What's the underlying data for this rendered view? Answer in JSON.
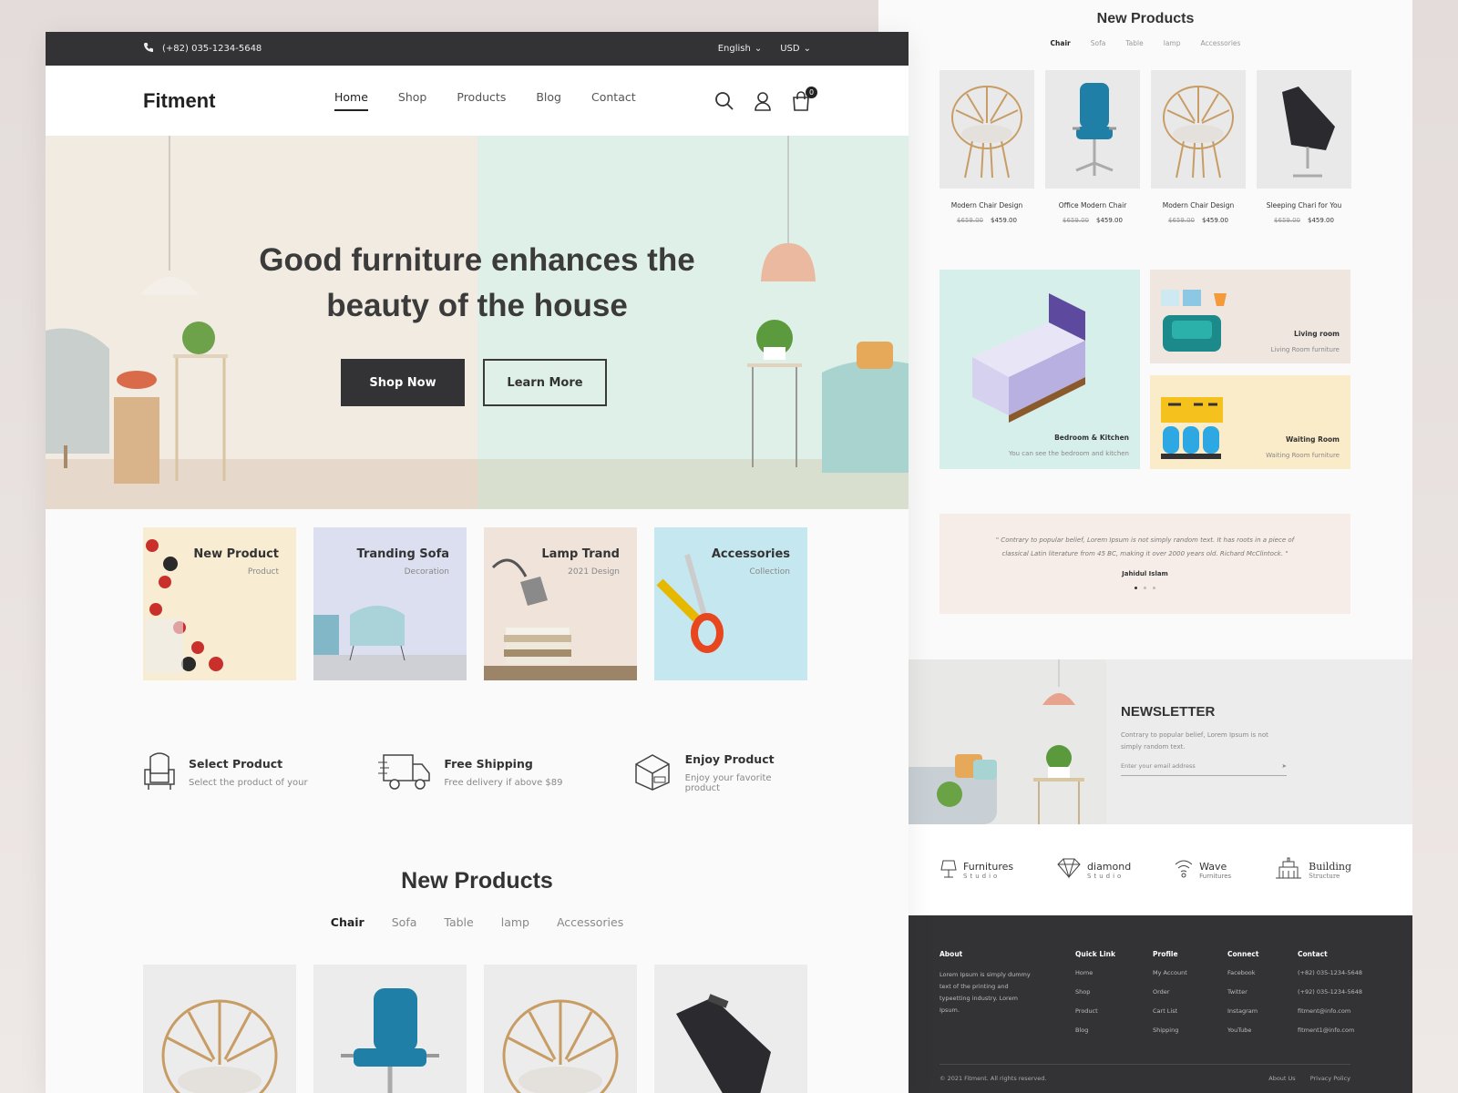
{
  "topbar": {
    "phone": "(+82) 035-1234-5648",
    "language": "English",
    "currency": "USD"
  },
  "nav": {
    "logo": "Fitment",
    "items": [
      {
        "label": "Home"
      },
      {
        "label": "Shop"
      },
      {
        "label": "Products"
      },
      {
        "label": "Blog"
      },
      {
        "label": "Contact"
      }
    ],
    "active_index": 0,
    "cart_count": "0"
  },
  "hero": {
    "headline_line1": "Good furniture enhances the",
    "headline_line2": "beauty of the house",
    "primary_cta": "Shop Now",
    "secondary_cta": "Learn More"
  },
  "categories": [
    {
      "title": "New Product",
      "subtitle": "Product"
    },
    {
      "title": "Tranding Sofa",
      "subtitle": "Decoration"
    },
    {
      "title": "Lamp Trand",
      "subtitle": "2021 Design"
    },
    {
      "title": "Accessories",
      "subtitle": "Collection"
    }
  ],
  "features": [
    {
      "title": "Select Product",
      "subtitle": "Select the product of your",
      "icon": "armchair-icon"
    },
    {
      "title": "Free Shipping",
      "subtitle": "Free delivery if above $89",
      "icon": "truck-icon"
    },
    {
      "title": "Enjoy Product",
      "subtitle": "Enjoy your favorite product",
      "icon": "box-icon"
    }
  ],
  "new_products": {
    "title": "New Products",
    "tabs": [
      "Chair",
      "Sofa",
      "Table",
      "lamp",
      "Accessories"
    ],
    "active_tab": 0
  },
  "right_products": {
    "title": "New Products",
    "tabs": [
      "Chair",
      "Sofa",
      "Table",
      "lamp",
      "Accessories"
    ],
    "items": [
      {
        "name": "Modern Chair Design",
        "old_price": "$659.00",
        "price": "$459.00"
      },
      {
        "name": "Office Modern Chair",
        "old_price": "$659.00",
        "price": "$459.00"
      },
      {
        "name": "Modern Chair Design",
        "old_price": "$659.00",
        "price": "$459.00"
      },
      {
        "name": "Sleeping Chari for You",
        "old_price": "$659.00",
        "price": "$459.00"
      }
    ]
  },
  "rooms": [
    {
      "title": "Bedroom & Kitchen",
      "subtitle": "You can see the bedroom and kitchen"
    },
    {
      "title": "Living room",
      "subtitle": "Living Room furniture"
    },
    {
      "title": "Waiting Room",
      "subtitle": "Waiting Room furniture"
    }
  ],
  "testimonial": {
    "quote": "\" Contrary to popular belief, Lorem Ipsum is not simply random text. It has roots in a piece of classical Latin literature from 45 BC, making it over 2000 years old. Richard McClintock. \"",
    "author": "Jahidul Islam"
  },
  "newsletter": {
    "title": "NEWSLETTER",
    "description": "Contrary to popular belief, Lorem Ipsum is not simply random text.",
    "placeholder": "Enter your email address"
  },
  "brands": [
    {
      "name": "Furnitures",
      "sub": "Studio"
    },
    {
      "name": "diamond",
      "sub": "Studio"
    },
    {
      "name": "Wave",
      "sub": "Furnitures"
    },
    {
      "name": "Building",
      "sub": "Structure"
    }
  ],
  "footer": {
    "about_title": "About",
    "about_text": "Lorem Ipsum is simply dummy text of the printing and typeetting industry. Lorem Ipsum.",
    "columns": [
      {
        "title": "Quick Link",
        "links": [
          "Home",
          "Shop",
          "Product",
          "Blog"
        ]
      },
      {
        "title": "Profile",
        "links": [
          "My Account",
          "Order",
          "Cart List",
          "Shipping"
        ]
      },
      {
        "title": "Connect",
        "links": [
          "Facebook",
          "Twitter",
          "Instagram",
          "YouTube"
        ]
      },
      {
        "title": "Contact",
        "links": [
          "(+82) 035-1234-5648",
          "(+92) 035-1234-5648",
          "fitment@info.com",
          "fitment1@info.com"
        ]
      }
    ],
    "copyright": "© 2021 Fitment. All rights reserved.",
    "bottom_links": [
      "About Us",
      "Privacy Policy"
    ]
  }
}
